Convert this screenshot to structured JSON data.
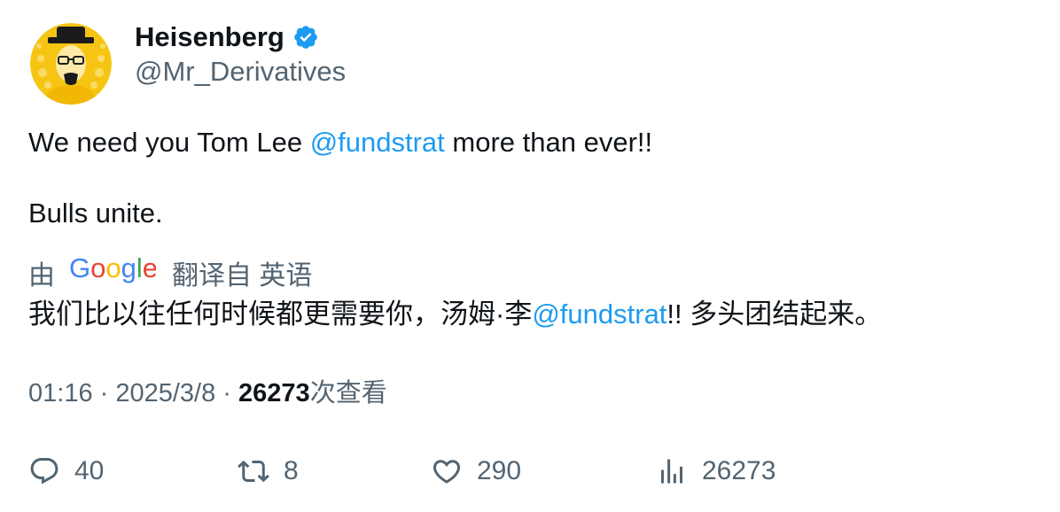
{
  "author": {
    "display_name": "Heisenberg",
    "handle": "@Mr_Derivatives",
    "verified": true,
    "avatar_icon": "heisenberg-avatar-icon",
    "verified_icon": "verified-badge-icon"
  },
  "tweet": {
    "line1_before": "We need you Tom Lee ",
    "line1_mention": "@fundstrat",
    "line1_after": " more than ever!!",
    "line2": "Bulls unite."
  },
  "translation": {
    "prefix": "由",
    "provider": "Google",
    "suffix": "翻译自 英语",
    "text_before": "我们比以往任何时候都更需要你，汤姆·李",
    "text_mention": "@fundstrat",
    "text_after": "!! 多头团结起来。"
  },
  "meta": {
    "time": "01:16",
    "separator": " · ",
    "date": "2025/3/8",
    "views": "26273",
    "views_label": "次查看"
  },
  "actions": {
    "replies": "40",
    "retweets": "8",
    "likes": "290",
    "views": "26273"
  },
  "colors": {
    "link": "#1d9bf0",
    "secondary": "#536471",
    "primary": "#0f1419",
    "verified": "#1d9bf0",
    "avatar_bg": "#f6c514"
  }
}
